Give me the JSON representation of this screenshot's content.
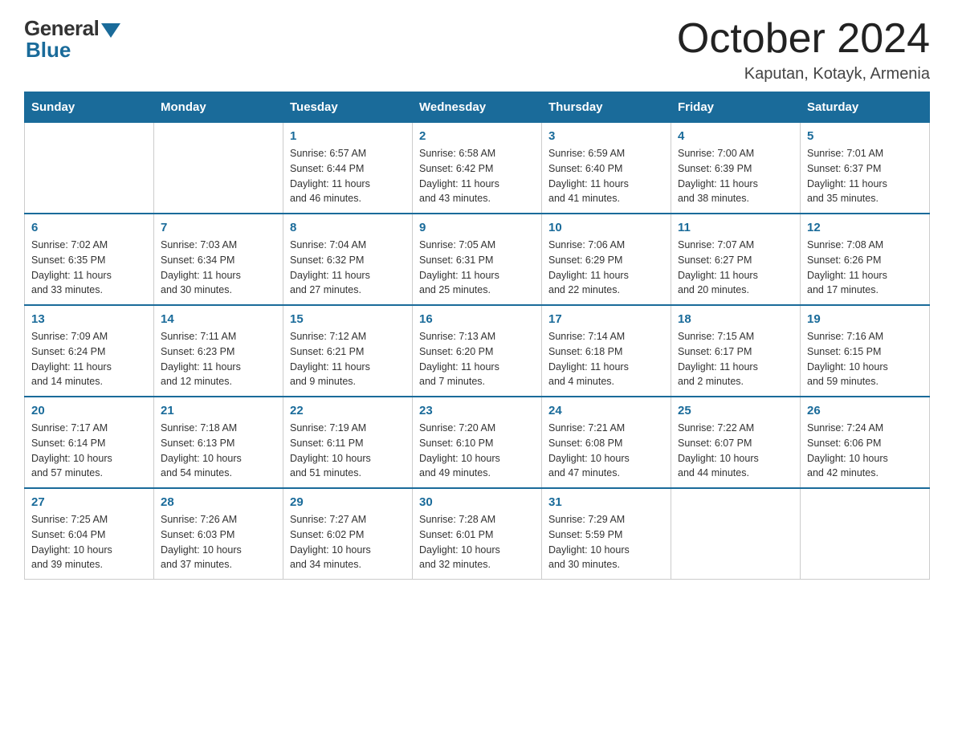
{
  "logo": {
    "general": "General",
    "blue": "Blue"
  },
  "title": "October 2024",
  "location": "Kaputan, Kotayk, Armenia",
  "days_header": [
    "Sunday",
    "Monday",
    "Tuesday",
    "Wednesday",
    "Thursday",
    "Friday",
    "Saturday"
  ],
  "weeks": [
    [
      {
        "day": "",
        "info": ""
      },
      {
        "day": "",
        "info": ""
      },
      {
        "day": "1",
        "info": "Sunrise: 6:57 AM\nSunset: 6:44 PM\nDaylight: 11 hours\nand 46 minutes."
      },
      {
        "day": "2",
        "info": "Sunrise: 6:58 AM\nSunset: 6:42 PM\nDaylight: 11 hours\nand 43 minutes."
      },
      {
        "day": "3",
        "info": "Sunrise: 6:59 AM\nSunset: 6:40 PM\nDaylight: 11 hours\nand 41 minutes."
      },
      {
        "day": "4",
        "info": "Sunrise: 7:00 AM\nSunset: 6:39 PM\nDaylight: 11 hours\nand 38 minutes."
      },
      {
        "day": "5",
        "info": "Sunrise: 7:01 AM\nSunset: 6:37 PM\nDaylight: 11 hours\nand 35 minutes."
      }
    ],
    [
      {
        "day": "6",
        "info": "Sunrise: 7:02 AM\nSunset: 6:35 PM\nDaylight: 11 hours\nand 33 minutes."
      },
      {
        "day": "7",
        "info": "Sunrise: 7:03 AM\nSunset: 6:34 PM\nDaylight: 11 hours\nand 30 minutes."
      },
      {
        "day": "8",
        "info": "Sunrise: 7:04 AM\nSunset: 6:32 PM\nDaylight: 11 hours\nand 27 minutes."
      },
      {
        "day": "9",
        "info": "Sunrise: 7:05 AM\nSunset: 6:31 PM\nDaylight: 11 hours\nand 25 minutes."
      },
      {
        "day": "10",
        "info": "Sunrise: 7:06 AM\nSunset: 6:29 PM\nDaylight: 11 hours\nand 22 minutes."
      },
      {
        "day": "11",
        "info": "Sunrise: 7:07 AM\nSunset: 6:27 PM\nDaylight: 11 hours\nand 20 minutes."
      },
      {
        "day": "12",
        "info": "Sunrise: 7:08 AM\nSunset: 6:26 PM\nDaylight: 11 hours\nand 17 minutes."
      }
    ],
    [
      {
        "day": "13",
        "info": "Sunrise: 7:09 AM\nSunset: 6:24 PM\nDaylight: 11 hours\nand 14 minutes."
      },
      {
        "day": "14",
        "info": "Sunrise: 7:11 AM\nSunset: 6:23 PM\nDaylight: 11 hours\nand 12 minutes."
      },
      {
        "day": "15",
        "info": "Sunrise: 7:12 AM\nSunset: 6:21 PM\nDaylight: 11 hours\nand 9 minutes."
      },
      {
        "day": "16",
        "info": "Sunrise: 7:13 AM\nSunset: 6:20 PM\nDaylight: 11 hours\nand 7 minutes."
      },
      {
        "day": "17",
        "info": "Sunrise: 7:14 AM\nSunset: 6:18 PM\nDaylight: 11 hours\nand 4 minutes."
      },
      {
        "day": "18",
        "info": "Sunrise: 7:15 AM\nSunset: 6:17 PM\nDaylight: 11 hours\nand 2 minutes."
      },
      {
        "day": "19",
        "info": "Sunrise: 7:16 AM\nSunset: 6:15 PM\nDaylight: 10 hours\nand 59 minutes."
      }
    ],
    [
      {
        "day": "20",
        "info": "Sunrise: 7:17 AM\nSunset: 6:14 PM\nDaylight: 10 hours\nand 57 minutes."
      },
      {
        "day": "21",
        "info": "Sunrise: 7:18 AM\nSunset: 6:13 PM\nDaylight: 10 hours\nand 54 minutes."
      },
      {
        "day": "22",
        "info": "Sunrise: 7:19 AM\nSunset: 6:11 PM\nDaylight: 10 hours\nand 51 minutes."
      },
      {
        "day": "23",
        "info": "Sunrise: 7:20 AM\nSunset: 6:10 PM\nDaylight: 10 hours\nand 49 minutes."
      },
      {
        "day": "24",
        "info": "Sunrise: 7:21 AM\nSunset: 6:08 PM\nDaylight: 10 hours\nand 47 minutes."
      },
      {
        "day": "25",
        "info": "Sunrise: 7:22 AM\nSunset: 6:07 PM\nDaylight: 10 hours\nand 44 minutes."
      },
      {
        "day": "26",
        "info": "Sunrise: 7:24 AM\nSunset: 6:06 PM\nDaylight: 10 hours\nand 42 minutes."
      }
    ],
    [
      {
        "day": "27",
        "info": "Sunrise: 7:25 AM\nSunset: 6:04 PM\nDaylight: 10 hours\nand 39 minutes."
      },
      {
        "day": "28",
        "info": "Sunrise: 7:26 AM\nSunset: 6:03 PM\nDaylight: 10 hours\nand 37 minutes."
      },
      {
        "day": "29",
        "info": "Sunrise: 7:27 AM\nSunset: 6:02 PM\nDaylight: 10 hours\nand 34 minutes."
      },
      {
        "day": "30",
        "info": "Sunrise: 7:28 AM\nSunset: 6:01 PM\nDaylight: 10 hours\nand 32 minutes."
      },
      {
        "day": "31",
        "info": "Sunrise: 7:29 AM\nSunset: 5:59 PM\nDaylight: 10 hours\nand 30 minutes."
      },
      {
        "day": "",
        "info": ""
      },
      {
        "day": "",
        "info": ""
      }
    ]
  ]
}
